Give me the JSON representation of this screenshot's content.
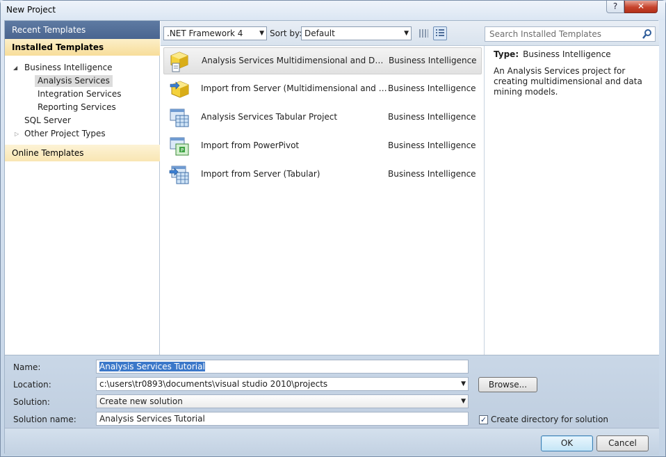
{
  "window": {
    "title": "New Project",
    "help_glyph": "?",
    "close_glyph": "✕"
  },
  "sidebar": {
    "recent_templates": "Recent Templates",
    "installed_templates": "Installed Templates",
    "online_templates": "Online Templates",
    "tree": {
      "business_intelligence": "Business Intelligence",
      "analysis_services": "Analysis Services",
      "integration_services": "Integration Services",
      "reporting_services": "Reporting Services",
      "sql_server": "SQL Server",
      "other_project_types": "Other Project Types"
    },
    "selected_item": "Analysis Services"
  },
  "toolbar": {
    "framework": ".NET Framework 4",
    "sort_label": "Sort by:",
    "sort_value": "Default",
    "search_placeholder": "Search Installed Templates",
    "active_view": "list"
  },
  "templates": [
    {
      "name": "Analysis Services Multidimensional and Data Mining Project",
      "category": "Business Intelligence",
      "icon": "cube-project-icon",
      "selected": true
    },
    {
      "name": "Import from Server (Multidimensional and Data Mining)",
      "category": "Business Intelligence",
      "icon": "cube-import-icon",
      "selected": false
    },
    {
      "name": "Analysis Services Tabular Project",
      "category": "Business Intelligence",
      "icon": "tabular-project-icon",
      "selected": false
    },
    {
      "name": "Import from PowerPivot",
      "category": "Business Intelligence",
      "icon": "powerpivot-icon",
      "selected": false
    },
    {
      "name": "Import from Server (Tabular)",
      "category": "Business Intelligence",
      "icon": "tabular-import-icon",
      "selected": false
    }
  ],
  "details": {
    "type_label": "Type:",
    "type_value": "Business Intelligence",
    "description": "An Analysis Services project for creating multidimensional and data mining models."
  },
  "form": {
    "name_label": "Name:",
    "name_value": "Analysis Services Tutorial",
    "location_label": "Location:",
    "location_value": "c:\\users\\tr0893\\documents\\visual studio 2010\\projects",
    "solution_label": "Solution:",
    "solution_value": "Create new solution",
    "solution_name_label": "Solution name:",
    "solution_name_value": "Analysis Services Tutorial",
    "browse_label": "Browse...",
    "create_directory_label": "Create directory for solution",
    "create_directory_checked": true,
    "ok_label": "OK",
    "cancel_label": "Cancel"
  },
  "colors": {
    "recent_header": "#4a6590",
    "installed_header": "#f7dd9a",
    "selection_highlight": "#3b78c9",
    "close_button": "#c6432c"
  }
}
